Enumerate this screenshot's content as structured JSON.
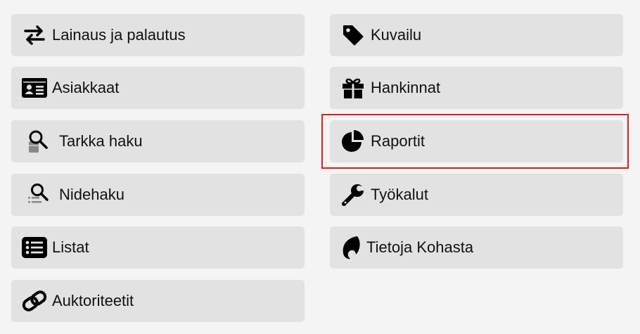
{
  "menu": {
    "left": [
      {
        "label": "Lainaus ja palautus",
        "icon": "exchange-arrows-icon"
      },
      {
        "label": "Asiakkaat",
        "icon": "id-card-icon"
      },
      {
        "label": "Tarkka haku",
        "icon": "book-search-icon"
      },
      {
        "label": "Nidehaku",
        "icon": "list-search-icon"
      },
      {
        "label": "Listat",
        "icon": "list-icon"
      },
      {
        "label": "Auktoriteetit",
        "icon": "link-icon"
      }
    ],
    "right": [
      {
        "label": "Kuvailu",
        "icon": "tag-icon"
      },
      {
        "label": "Hankinnat",
        "icon": "gift-icon"
      },
      {
        "label": "Raportit",
        "icon": "pie-chart-icon",
        "selected": true
      },
      {
        "label": "Työkalut",
        "icon": "wrench-icon"
      },
      {
        "label": "Tietoja Kohasta",
        "icon": "koha-logo-icon"
      }
    ]
  },
  "colors": {
    "page_background": "#f3f4f3",
    "tile_background": "#e2e2e2",
    "selection_outline": "#e01a1a",
    "text": "#111111"
  }
}
